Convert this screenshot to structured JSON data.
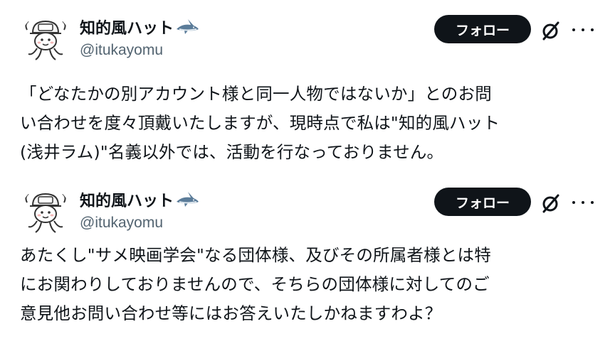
{
  "posts": [
    {
      "author": {
        "name": "知的風ハット",
        "handle": "@itukayomu",
        "name_emoji": "shark-icon"
      },
      "follow_label": "フォロー",
      "text_lines": [
        "「どなたかの別アカウント様と同一人物ではないか」とのお問",
        "い合わせを度々頂戴いたしますが、現時点で私は\"知的風ハット",
        "(浅井ラム)\"名義以外では、活動を行なっておりません。"
      ]
    },
    {
      "author": {
        "name": "知的風ハット",
        "handle": "@itukayomu",
        "name_emoji": "shark-icon"
      },
      "follow_label": "フォロー",
      "text_lines": [
        "あたくし\"サメ映画学会\"なる団体様、及びその所属者様とは特",
        "にお関わりしておりませんので、そちらの団体様に対してのご",
        "意見他お問い合わせ等にはお答えいたしかねますわよ？"
      ]
    }
  ],
  "colors": {
    "text": "#0f1419",
    "secondary": "#536471",
    "button_bg": "#0f1419",
    "button_text": "#ffffff"
  }
}
